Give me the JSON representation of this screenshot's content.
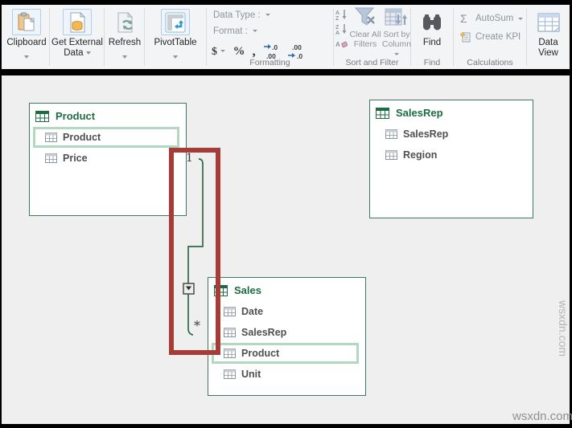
{
  "ribbon": {
    "clipboard": {
      "label": "Clipboard"
    },
    "get_external_data": {
      "label": "Get External Data"
    },
    "refresh": {
      "label": "Refresh"
    },
    "pivottable": {
      "label": "PivotTable"
    },
    "formatting": {
      "group_label": "Formatting",
      "data_type_label": "Data Type :",
      "format_label": "Format :",
      "currency_symbol": "$",
      "percent_symbol": "%",
      "comma_symbol": ",",
      "dec_small": ".0",
      "dec_large": ".00"
    },
    "sort_and_filter": {
      "group_label": "Sort and Filter",
      "clear_all_filters_label": "Clear All\nFilters",
      "sort_by_column_label": "Sort by\nColumn",
      "sort_letter_a": "A",
      "sort_letter_z": "Z"
    },
    "find": {
      "button_label": "Find",
      "group_label": "Find"
    },
    "calculations": {
      "group_label": "Calculations",
      "autosum_label": "AutoSum",
      "create_kpi_label": "Create KPI",
      "sigma": "Σ"
    },
    "data_view": {
      "label": "Data\nView"
    }
  },
  "diagram": {
    "tables": [
      {
        "name": "Product",
        "fields": [
          {
            "name": "Product",
            "selected": true
          },
          {
            "name": "Price",
            "selected": false
          }
        ]
      },
      {
        "name": "SalesRep",
        "fields": [
          {
            "name": "SalesRep",
            "selected": false
          },
          {
            "name": "Region",
            "selected": false
          }
        ]
      },
      {
        "name": "Sales",
        "fields": [
          {
            "name": "Date",
            "selected": false
          },
          {
            "name": "SalesRep",
            "selected": false
          },
          {
            "name": "Product",
            "selected": true
          },
          {
            "name": "Unit",
            "selected": false
          }
        ]
      }
    ],
    "relationship": {
      "from": "Product.Product",
      "to": "Sales.Product",
      "one_label": "1",
      "many_label": "*"
    }
  },
  "watermark": {
    "text": "wsxdn.com"
  },
  "colors": {
    "excel_green": "#1e6b41",
    "highlight_green": "#b2d8c0",
    "annotation_red": "#a53c38"
  }
}
